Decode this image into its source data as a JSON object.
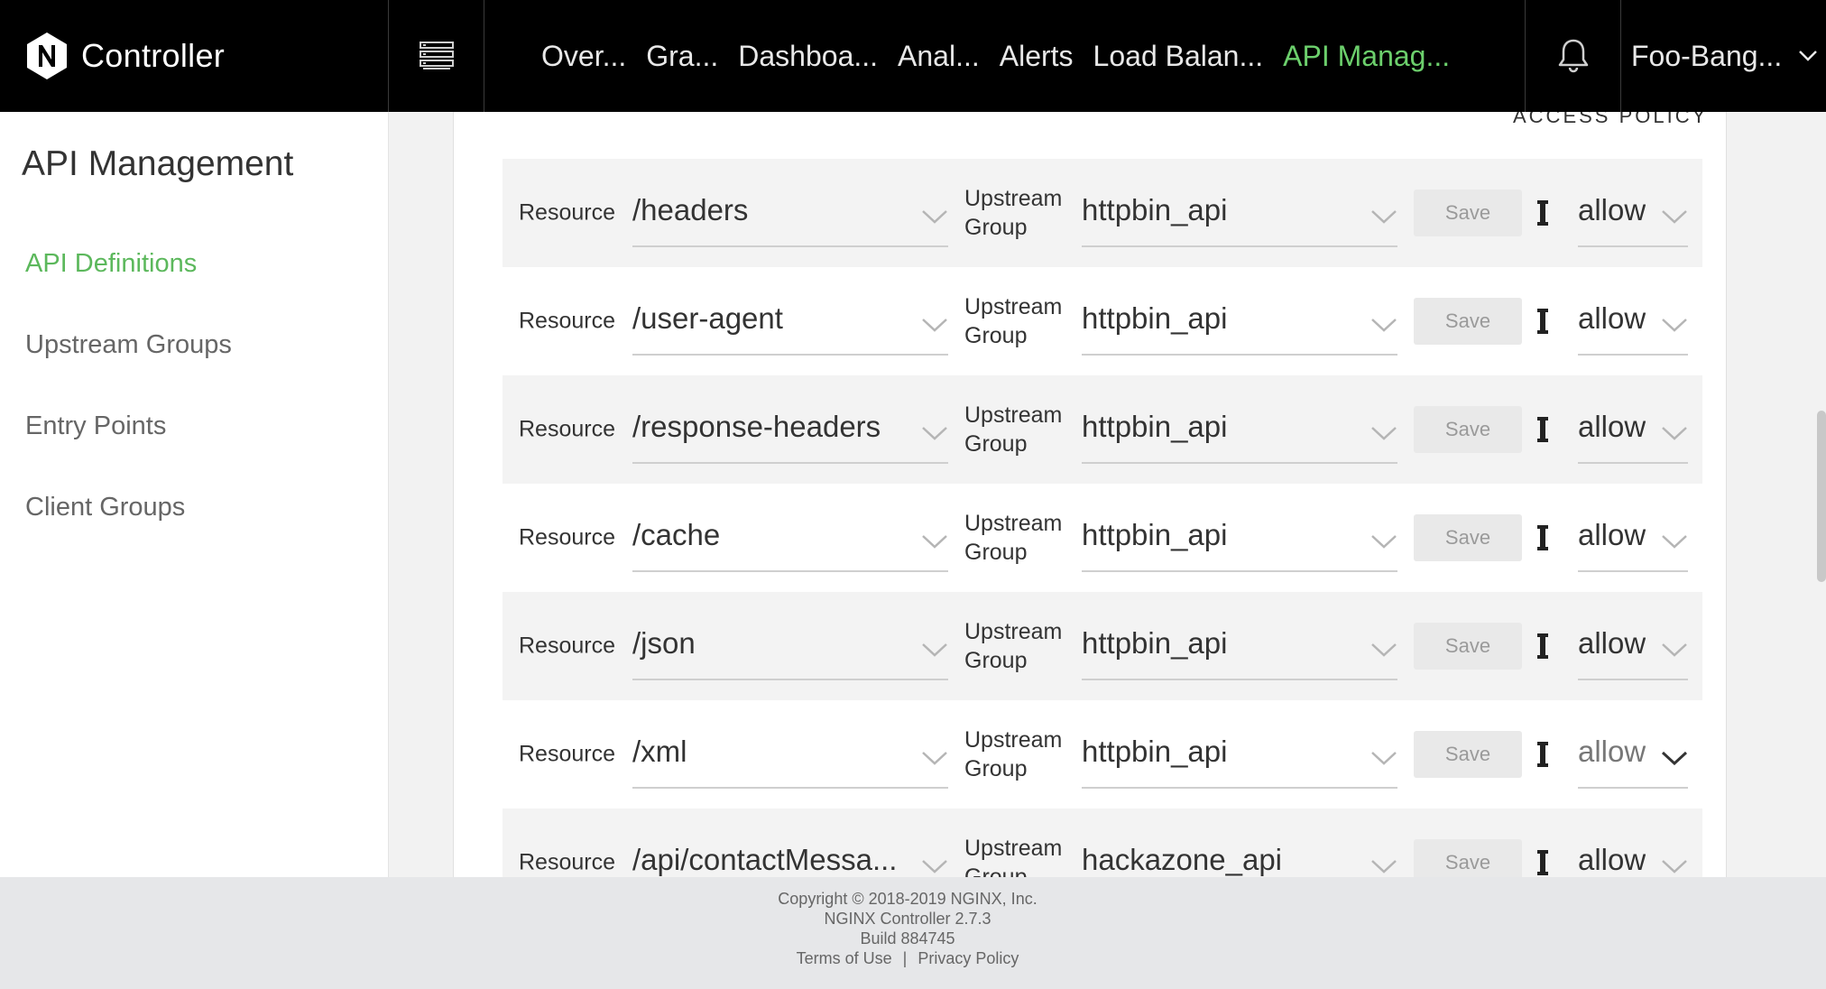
{
  "brand": {
    "name": "Controller"
  },
  "nav": {
    "items": [
      {
        "label": "Over..."
      },
      {
        "label": "Gra..."
      },
      {
        "label": "Dashboa..."
      },
      {
        "label": "Anal..."
      },
      {
        "label": "Alerts"
      },
      {
        "label": "Load Balan..."
      },
      {
        "label": "API Manag..."
      }
    ],
    "account": "Foo-Bang...",
    "active_color": "#6ccf6c"
  },
  "sidebar": {
    "title": "API Management",
    "items": [
      {
        "label": "API Definitions"
      },
      {
        "label": "Upstream Groups"
      },
      {
        "label": "Entry Points"
      },
      {
        "label": "Client Groups"
      }
    ],
    "active_color": "#5cb85c"
  },
  "table": {
    "column_header": "ACCESS POLICY",
    "resource_label": "Resource",
    "upstream_label_line1": "Upstream",
    "upstream_label_line2": "Group",
    "save_label": "Save",
    "rows": [
      {
        "resource": "/headers",
        "upstream": "httpbin_api",
        "policy": "allow"
      },
      {
        "resource": "/user-agent",
        "upstream": "httpbin_api",
        "policy": "allow"
      },
      {
        "resource": "/response-headers",
        "upstream": "httpbin_api",
        "policy": "allow"
      },
      {
        "resource": "/cache",
        "upstream": "httpbin_api",
        "policy": "allow"
      },
      {
        "resource": "/json",
        "upstream": "httpbin_api",
        "policy": "allow"
      },
      {
        "resource": "/xml",
        "upstream": "httpbin_api",
        "policy": "allow"
      },
      {
        "resource": "/api/contactMessa...",
        "upstream": "hackazone_api",
        "policy": "allow"
      }
    ]
  },
  "footer": {
    "copyright": "Copyright © 2018-2019 NGINX, Inc.",
    "version": "NGINX Controller 2.7.3",
    "build": "Build 884745",
    "terms": "Terms of Use",
    "separator": "|",
    "privacy": "Privacy Policy"
  }
}
